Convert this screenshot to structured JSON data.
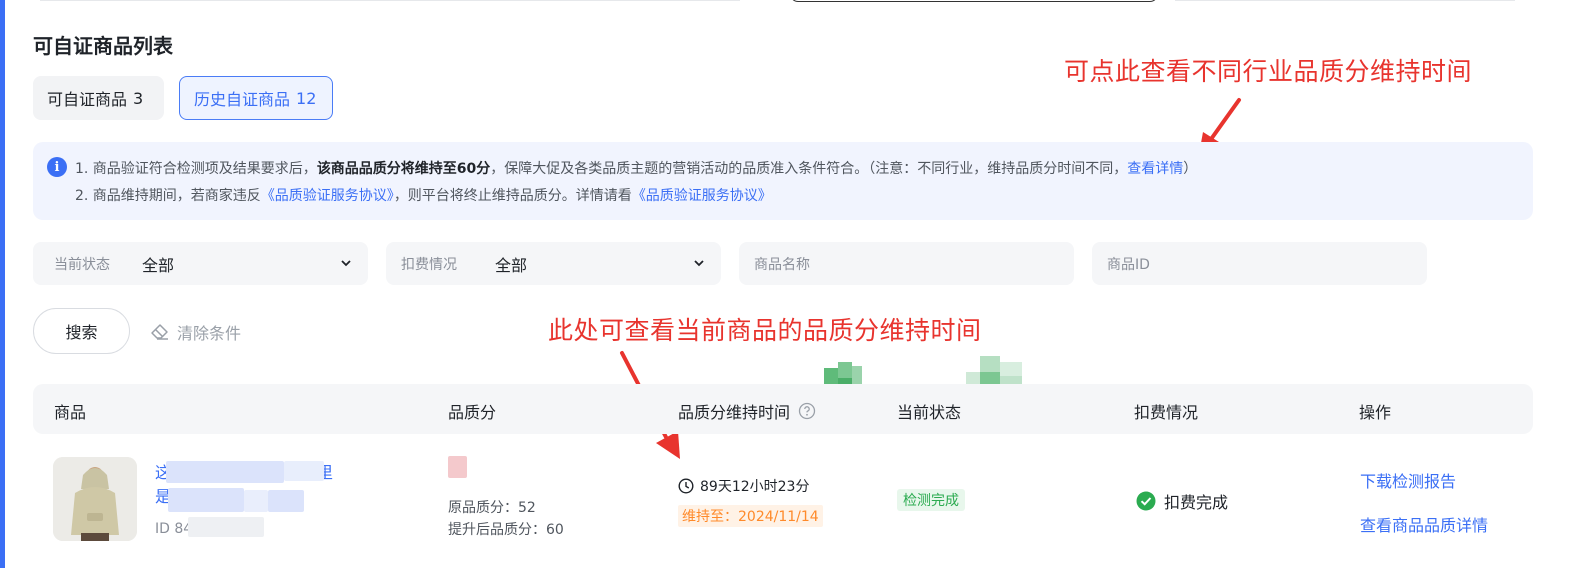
{
  "page_title": "可自证商品列表",
  "tabs": [
    {
      "label": "可自证商品",
      "count": "3",
      "active": false
    },
    {
      "label": "历史自证商品",
      "count": "12",
      "active": true
    }
  ],
  "annotations": {
    "industry_time": "可点此查看不同行业品质分维持时间",
    "current_time": "此处可查看当前商品的品质分维持时间"
  },
  "notice": {
    "line1_prefix": "1.  商品验证符合检测项及结果要求后，",
    "line1_bold": "该商品品质分将维持至60分",
    "line1_suffix": "，保障大促及各类品质主题的营销活动的品质准入条件符合。（注意：不同行业，维持品质分时间不同，",
    "line1_link": "查看详情",
    "line1_end": "）",
    "line2_prefix": "2.  商品维持期间，若商家违反",
    "line2_link1": "《品质验证服务协议》",
    "line2_mid": "，则平台将终止维持品质分。详情请看",
    "line2_link2": "《品质验证服务协议》"
  },
  "filters": {
    "status_label": "当前状态",
    "status_value": "全部",
    "fee_label": "扣费情况",
    "fee_value": "全部",
    "name_placeholder": "商品名称",
    "id_placeholder": "商品ID"
  },
  "actions": {
    "search": "搜索",
    "clear": "清除条件"
  },
  "table": {
    "columns": [
      "商品",
      "品质分",
      "品质分维持时间",
      "当前状态",
      "扣费情况",
      "操作"
    ],
    "rows": [
      {
        "name_line1": "这",
        "name_line1_end": "里",
        "name_line2": "是",
        "id": "ID 84",
        "original_score": "原品质分：52",
        "boosted_score": "提升后品质分：60",
        "remaining_time": "89天12小时23分",
        "maintain_until": "维持至：2024/11/14",
        "status": "检测完成",
        "fee_status": "扣费完成",
        "op_download": "下载检测报告",
        "op_detail": "查看商品品质详情"
      }
    ]
  },
  "colors": {
    "accent": "#3b6ff5",
    "annotation": "#e8342e",
    "success": "#2bab50",
    "warning": "#ff8a2a"
  }
}
